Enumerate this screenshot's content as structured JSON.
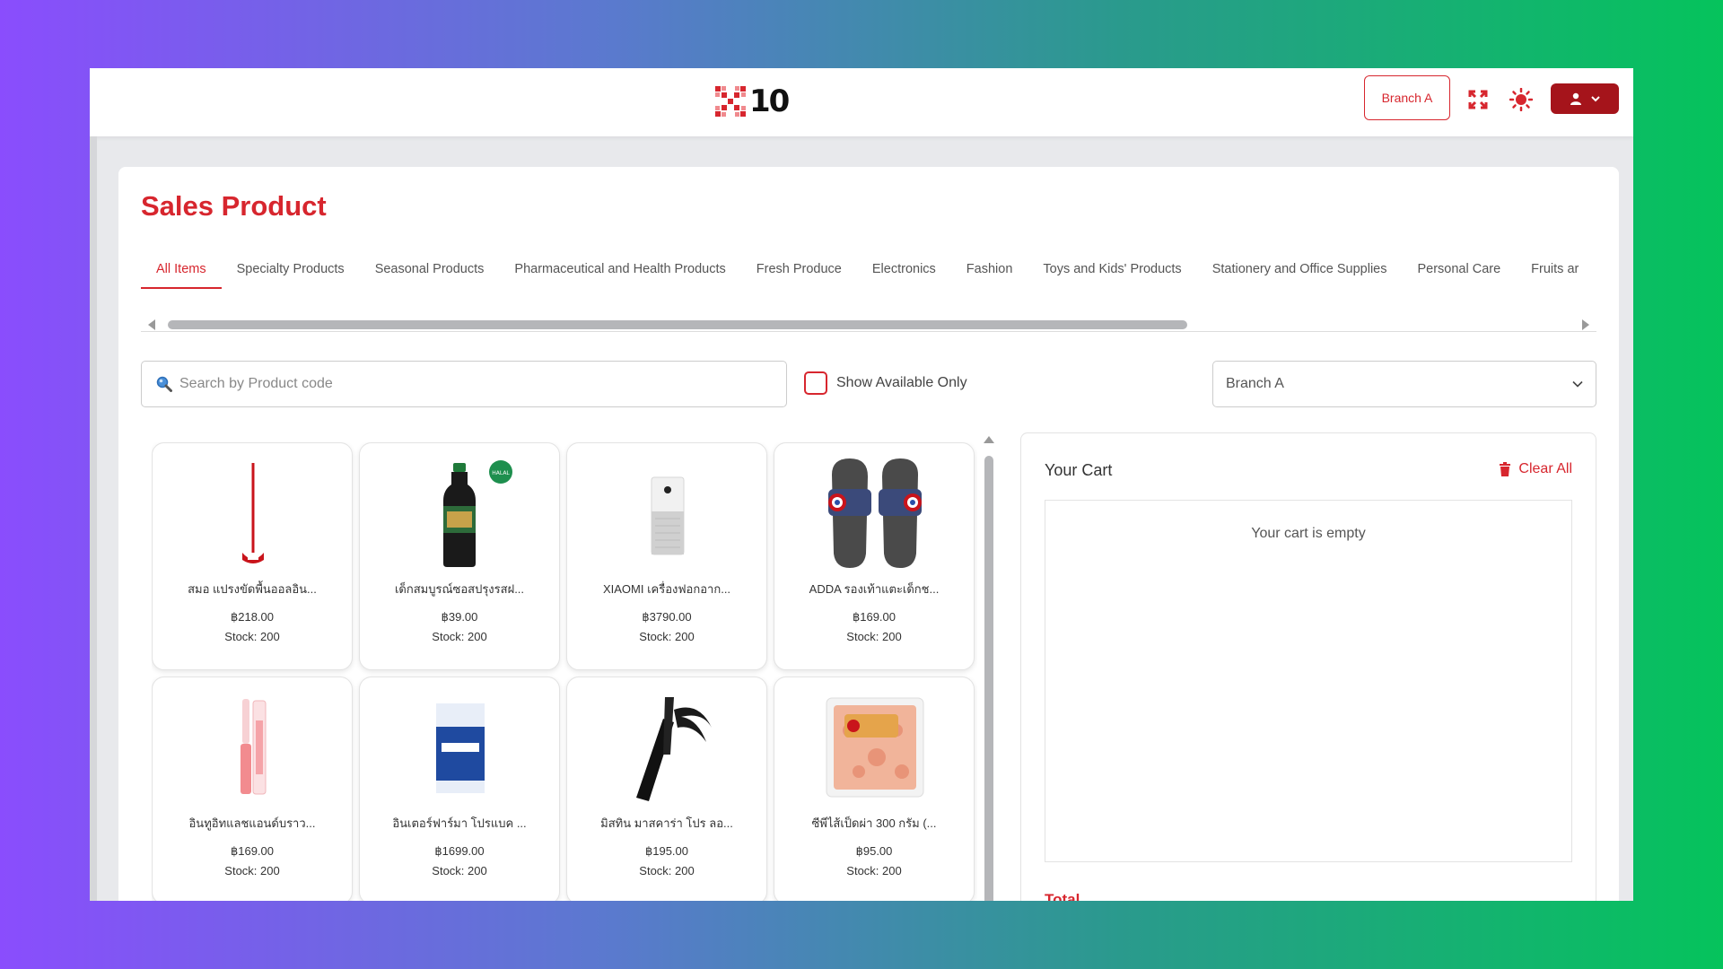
{
  "app": {
    "logo_text": "10",
    "branch_button": "Branch A",
    "colors": {
      "accent": "#d7262e",
      "accent_dark": "#a5141b"
    },
    "icons": {
      "fullscreen": "expand-icon",
      "theme": "sun-icon",
      "user": "user-icon",
      "menu": "chevron-down-icon"
    }
  },
  "page": {
    "title": "Sales Product"
  },
  "tabs": [
    {
      "label": "All Items",
      "active": true
    },
    {
      "label": "Specialty Products"
    },
    {
      "label": "Seasonal Products"
    },
    {
      "label": "Pharmaceutical and Health Products"
    },
    {
      "label": "Fresh Produce"
    },
    {
      "label": "Electronics"
    },
    {
      "label": "Fashion"
    },
    {
      "label": "Toys and Kids' Products"
    },
    {
      "label": "Stationery and Office Supplies"
    },
    {
      "label": "Personal Care"
    },
    {
      "label": "Fruits ar"
    }
  ],
  "filters": {
    "search_placeholder": "Search by Product code",
    "search_value": "",
    "show_available_label": "Show Available Only",
    "show_available_checked": false,
    "branch_selected": "Branch A"
  },
  "products": [
    {
      "name": "สมอ แปรงขัดพื้นออลอิน...",
      "price": "฿218.00",
      "stock": "Stock: 200",
      "icon": "mop-icon"
    },
    {
      "name": "เด็กสมบูรณ์ซอสปรุงรสฝ...",
      "price": "฿39.00",
      "stock": "Stock: 200",
      "icon": "sauce-bottle-icon",
      "badge": "HALAL"
    },
    {
      "name": "XIAOMI เครื่องฟอกอาก...",
      "price": "฿3790.00",
      "stock": "Stock: 200",
      "icon": "air-purifier-icon"
    },
    {
      "name": "ADDA รองเท้าแตะเด็กช...",
      "price": "฿169.00",
      "stock": "Stock: 200",
      "icon": "sandals-icon"
    },
    {
      "name": "อินทูอิทแลชแอนด์บราว...",
      "price": "฿169.00",
      "stock": "Stock: 200",
      "icon": "lip-gloss-icon"
    },
    {
      "name": "อินเตอร์ฟาร์มา โปรแบค ...",
      "price": "฿1699.00",
      "stock": "Stock: 200",
      "icon": "supplement-box-icon"
    },
    {
      "name": "มิสทิน มาสคาร่า โปร ลอ...",
      "price": "฿195.00",
      "stock": "Stock: 200",
      "icon": "mascara-icon"
    },
    {
      "name": "ซีพีไส้เป็ดผ่า 300 กรัม (...",
      "price": "฿95.00",
      "stock": "Stock: 200",
      "icon": "food-pack-icon"
    }
  ],
  "cart": {
    "title": "Your Cart",
    "clear_all": "Clear All",
    "empty_text": "Your cart is empty",
    "total_label": "Total"
  }
}
